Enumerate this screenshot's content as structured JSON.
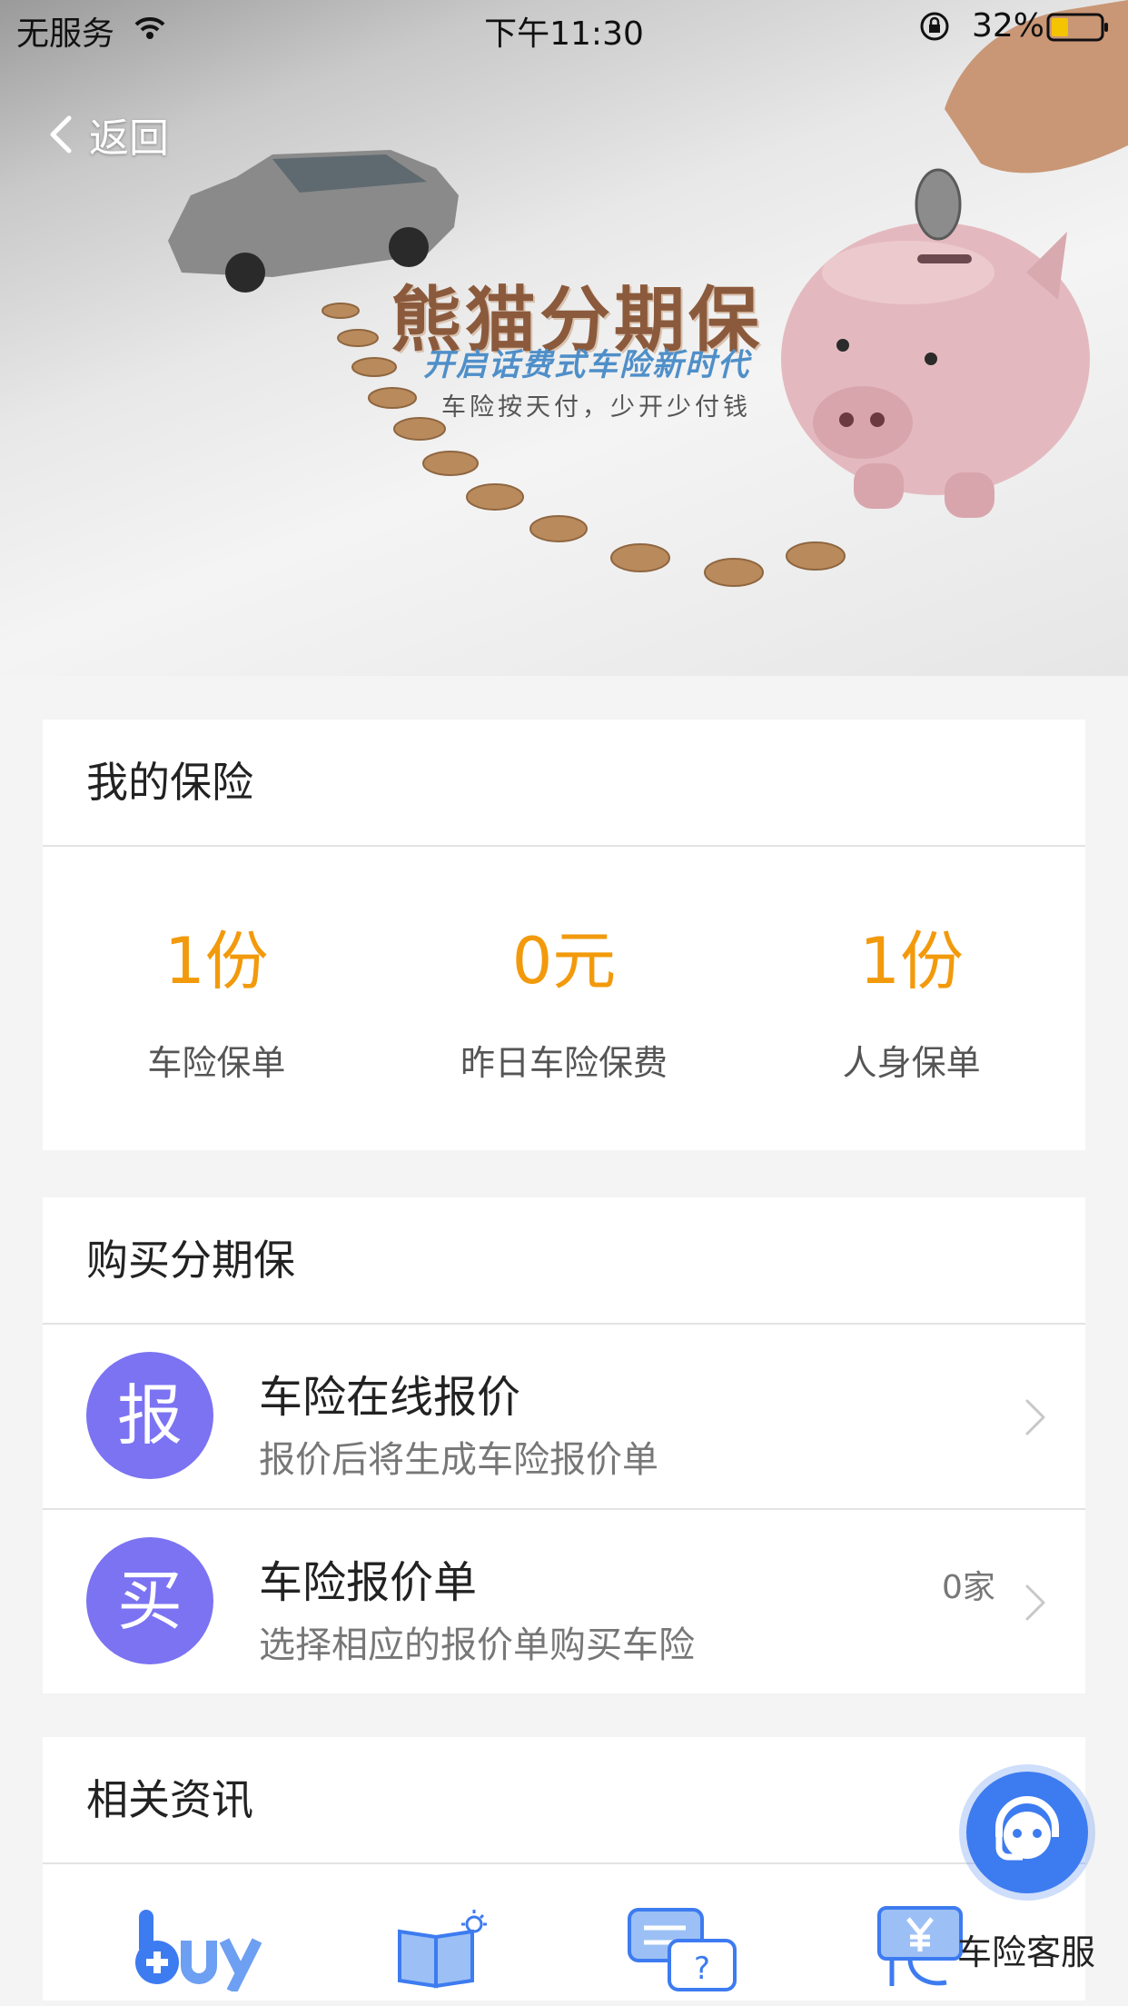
{
  "status_bar": {
    "carrier": "无服务",
    "time": "下午11:30",
    "battery_percent": "32%"
  },
  "nav": {
    "back_label": "返回"
  },
  "banner": {
    "title": "熊猫分期保",
    "subtitle": "开启话费式车险新时代",
    "slogan": "车险按天付，少开少付钱"
  },
  "my_insurance": {
    "title": "我的保险",
    "stats": [
      {
        "value": "1份",
        "label": "车险保单"
      },
      {
        "value": "0元",
        "label": "昨日车险保费"
      },
      {
        "value": "1份",
        "label": "人身保单"
      }
    ]
  },
  "buy": {
    "title": "购买分期保",
    "items": [
      {
        "badge": "报",
        "title": "车险在线报价",
        "desc": "报价后将生成车险报价单",
        "count": ""
      },
      {
        "badge": "买",
        "title": "车险报价单",
        "desc": "选择相应的报价单购买车险",
        "count": "0家"
      }
    ]
  },
  "news": {
    "title": "相关资讯",
    "icons": [
      "buy-icon",
      "book-bulb-icon",
      "chat-question-icon",
      "yuan-card-icon"
    ]
  },
  "service": {
    "label": "车险客服"
  },
  "colors": {
    "accent_orange": "#f29a0c",
    "badge_purple": "#7b73f2",
    "service_blue": "#3d7bf0",
    "icon_blue": "#5a8ff0"
  }
}
